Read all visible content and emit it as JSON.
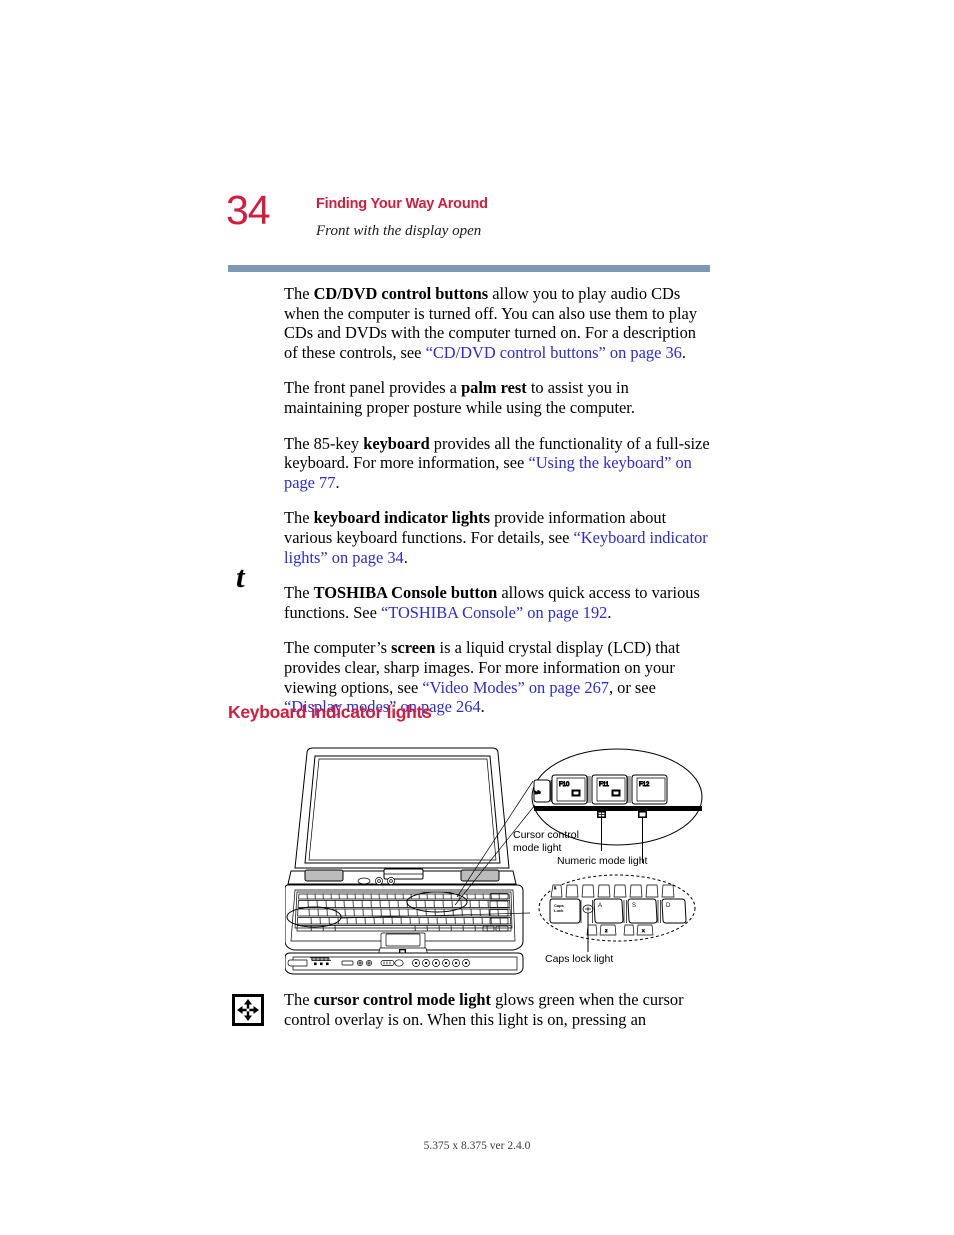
{
  "header": {
    "page_number": "34",
    "title": "Finding Your Way Around",
    "subtitle": "Front with the display open",
    "rule_color": "#7f99b4",
    "accent_color": "#d21e3c"
  },
  "link_color": "#2b2bd4",
  "body": {
    "paragraphs": [
      {
        "id": "p-cddvd",
        "runs": [
          {
            "t": "The ",
            "s": "plain"
          },
          {
            "t": "CD/DVD control buttons",
            "s": "bold"
          },
          {
            "t": " allow you to play audio CDs when the computer is turned off. You can also use them to play CDs and DVDs with the computer turned on. For a description of these controls, see ",
            "s": "plain"
          },
          {
            "t": "“CD/DVD control buttons” on page 36",
            "s": "link"
          },
          {
            "t": ".",
            "s": "plain"
          }
        ]
      },
      {
        "id": "p-palmrest",
        "runs": [
          {
            "t": "The front panel provides a ",
            "s": "plain"
          },
          {
            "t": "palm rest",
            "s": "bold"
          },
          {
            "t": " to assist you in maintaining proper posture while using the computer.",
            "s": "plain"
          }
        ]
      },
      {
        "id": "p-keyboard",
        "runs": [
          {
            "t": "The 85-key ",
            "s": "plain"
          },
          {
            "t": "keyboard",
            "s": "bold"
          },
          {
            "t": " provides all the functionality of a full-size keyboard. For more information, see ",
            "s": "plain"
          },
          {
            "t": "“Using the keyboard” on page 77",
            "s": "link"
          },
          {
            "t": ".",
            "s": "plain"
          }
        ]
      },
      {
        "id": "p-indicator-lights",
        "runs": [
          {
            "t": "The ",
            "s": "plain"
          },
          {
            "t": "keyboard indicator lights",
            "s": "bold"
          },
          {
            "t": " provide information about various keyboard functions. For details, see ",
            "s": "plain"
          },
          {
            "t": "“Keyboard indicator lights” on page 34",
            "s": "link"
          },
          {
            "t": ".",
            "s": "plain"
          }
        ]
      },
      {
        "id": "p-console-button",
        "runs": [
          {
            "t": "The ",
            "s": "plain"
          },
          {
            "t": "TOSHIBA Console button",
            "s": "bold"
          },
          {
            "t": " allows quick access to various functions. See ",
            "s": "plain"
          },
          {
            "t": "“TOSHIBA Console” on page 192",
            "s": "link"
          },
          {
            "t": ".",
            "s": "plain"
          }
        ]
      },
      {
        "id": "p-screen",
        "runs": [
          {
            "t": "The computer’s ",
            "s": "plain"
          },
          {
            "t": "screen",
            "s": "bold"
          },
          {
            "t": " is a liquid crystal display (LCD) that provides clear, sharp images. For more information on your viewing options, see ",
            "s": "plain"
          },
          {
            "t": "“Video Modes” on page 267",
            "s": "link"
          },
          {
            "t": ", or see ",
            "s": "plain"
          },
          {
            "t": "“Display modes” on page 264",
            "s": "link"
          },
          {
            "t": ".",
            "s": "plain"
          }
        ]
      }
    ]
  },
  "tip_marker": {
    "glyph": "t",
    "name": "toshiba-tip-icon"
  },
  "section": {
    "heading": "Keyboard indicator lights"
  },
  "figure": {
    "alt": "Laptop front view with display open showing keyboard indicator light locations",
    "callouts": [
      {
        "id": "cursor-control",
        "lines": [
          "Cursor control",
          "mode light"
        ]
      },
      {
        "id": "numeric-mode",
        "lines": [
          "Numeric mode light"
        ]
      },
      {
        "id": "caps-lock",
        "lines": [
          "Caps lock light"
        ]
      }
    ],
    "detail_top_keys": [
      "F10",
      "F11",
      "F12"
    ],
    "detail_top_left_key": "b/b",
    "detail_bottom_keys": [
      "Caps\nLock",
      "A",
      "S",
      "D"
    ],
    "detail_bottom_row2_keys": [
      "Z",
      "X"
    ],
    "detail_bottom_row0_key": "1"
  },
  "note": {
    "icon_name": "cursor-control-mode-icon",
    "runs": [
      {
        "t": "The ",
        "s": "plain"
      },
      {
        "t": "cursor control mode light",
        "s": "bold"
      },
      {
        "t": " glows green when the cursor control overlay is on. When this light is on, pressing an",
        "s": "plain"
      }
    ]
  },
  "footer": {
    "text": "5.375 x 8.375 ver 2.4.0"
  }
}
